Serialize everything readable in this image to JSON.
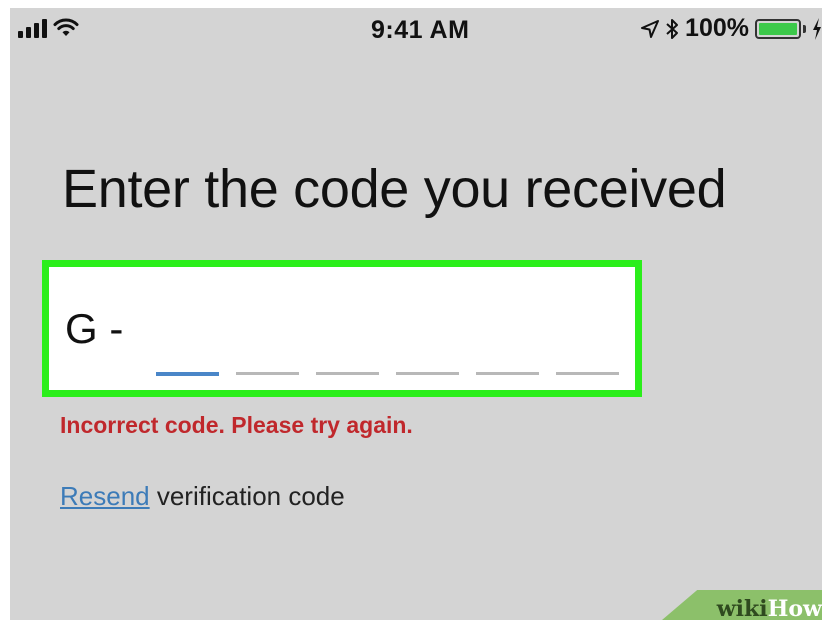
{
  "status_bar": {
    "time": "9:41 AM",
    "battery_percent": "100%",
    "battery_level": 1.0,
    "icons": [
      "signal-icon",
      "wifi-icon",
      "location-arrow-icon",
      "bluetooth-icon",
      "battery-icon",
      "charging-bolt-icon"
    ],
    "battery_color": "#3cc94a"
  },
  "screen": {
    "heading": "Enter the code you received",
    "code_input": {
      "prefix": "G -",
      "digit_count": 6,
      "active_slot": 0,
      "border_color": "#2bee1b"
    },
    "error_message": "Incorrect code. Please try again.",
    "error_color": "#c0282c",
    "resend_link_label": "Resend",
    "resend_suffix": " verification code",
    "link_color": "#3c7bb8"
  },
  "watermark": {
    "wiki": "wiki",
    "how": "How"
  }
}
